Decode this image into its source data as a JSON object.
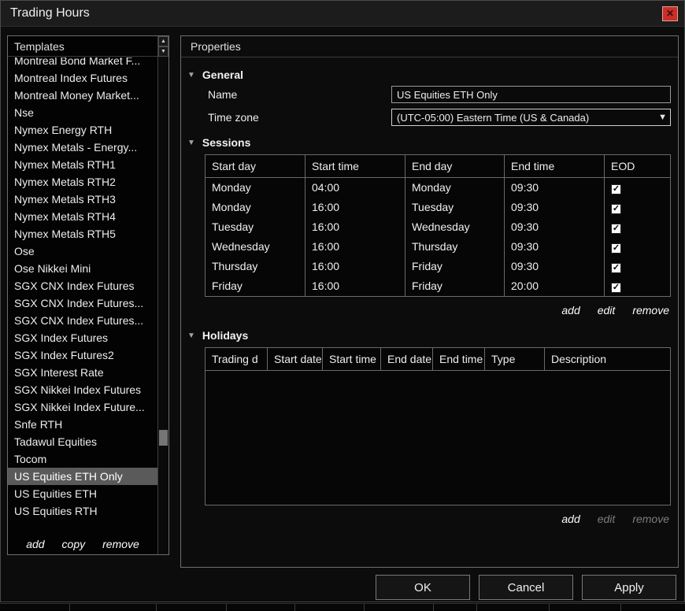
{
  "icons": {
    "close": "✕",
    "scroll_up": "▲",
    "scroll_down": "▼",
    "dropdown_arrow": "▼",
    "collapse_arrow": "▼",
    "checkmark": "✓"
  },
  "window": {
    "title": "Trading Hours"
  },
  "templates": {
    "header": "Templates",
    "selected_index": 24,
    "items": [
      "Montreal Bond Market F...",
      "Montreal Index Futures",
      "Montreal Money Market...",
      "Nse",
      "Nymex Energy RTH",
      "Nymex Metals - Energy...",
      "Nymex Metals RTH1",
      "Nymex Metals RTH2",
      "Nymex Metals RTH3",
      "Nymex Metals RTH4",
      "Nymex Metals RTH5",
      "Ose",
      "Ose Nikkei Mini",
      "SGX CNX Index Futures",
      "SGX CNX Index Futures...",
      "SGX CNX Index Futures...",
      "SGX Index Futures",
      "SGX Index Futures2",
      "SGX Interest Rate",
      "SGX Nikkei Index Futures",
      "SGX Nikkei Index Future...",
      "Snfe RTH",
      "Tadawul Equities",
      "Tocom",
      "US Equities ETH Only",
      "US Equities ETH",
      "US Equities RTH"
    ],
    "actions": {
      "add": "add",
      "copy": "copy",
      "remove": "remove"
    }
  },
  "properties": {
    "header": "Properties",
    "general": {
      "label": "General",
      "name_label": "Name",
      "name_value": "US Equities ETH Only",
      "timezone_label": "Time zone",
      "timezone_value": "(UTC-05:00) Eastern Time (US & Canada)"
    },
    "sessions": {
      "label": "Sessions",
      "columns": [
        "Start day",
        "Start time",
        "End day",
        "End time",
        "EOD"
      ],
      "rows": [
        {
          "start_day": "Monday",
          "start_time": "04:00",
          "end_day": "Monday",
          "end_time": "09:30",
          "eod": true
        },
        {
          "start_day": "Monday",
          "start_time": "16:00",
          "end_day": "Tuesday",
          "end_time": "09:30",
          "eod": true
        },
        {
          "start_day": "Tuesday",
          "start_time": "16:00",
          "end_day": "Wednesday",
          "end_time": "09:30",
          "eod": true
        },
        {
          "start_day": "Wednesday",
          "start_time": "16:00",
          "end_day": "Thursday",
          "end_time": "09:30",
          "eod": true
        },
        {
          "start_day": "Thursday",
          "start_time": "16:00",
          "end_day": "Friday",
          "end_time": "09:30",
          "eod": true
        },
        {
          "start_day": "Friday",
          "start_time": "16:00",
          "end_day": "Friday",
          "end_time": "20:00",
          "eod": true
        }
      ],
      "actions": {
        "add": "add",
        "edit": "edit",
        "remove": "remove"
      }
    },
    "holidays": {
      "label": "Holidays",
      "columns": [
        "Trading d",
        "Start date",
        "Start time",
        "End date",
        "End time",
        "Type",
        "Description"
      ],
      "rows": [],
      "actions": {
        "add": "add",
        "edit": "edit",
        "remove": "remove"
      }
    }
  },
  "footer": {
    "ok": "OK",
    "cancel": "Cancel",
    "apply": "Apply"
  }
}
